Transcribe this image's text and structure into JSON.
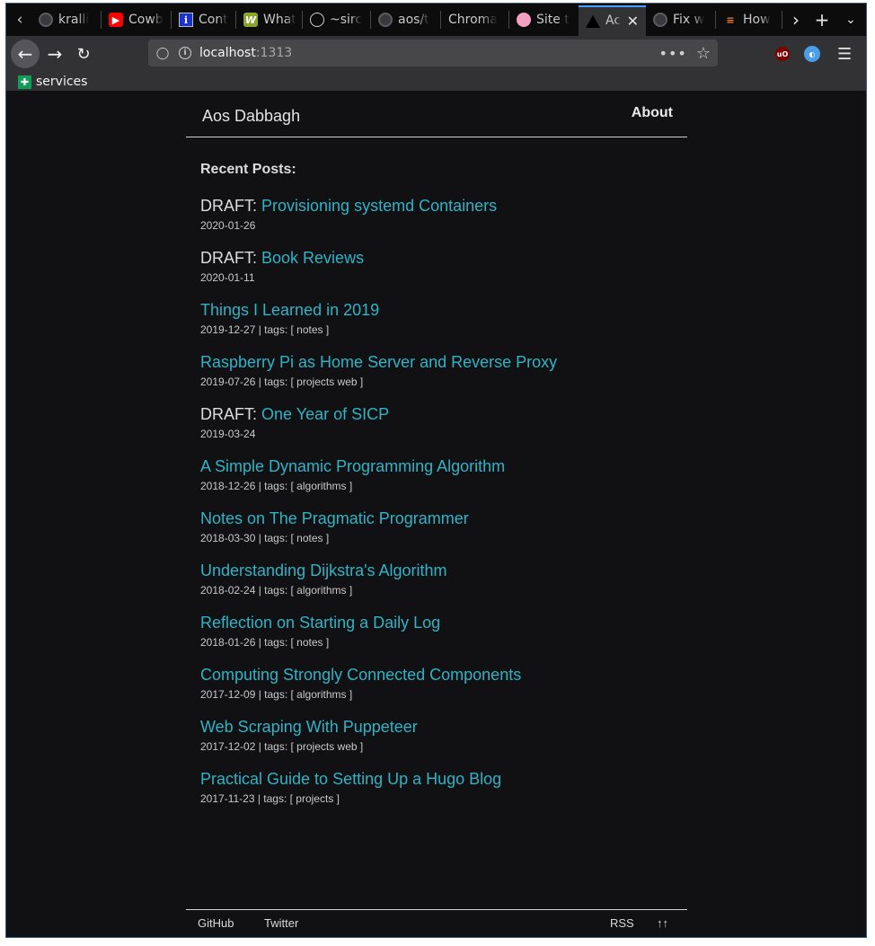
{
  "browser": {
    "tabs": [
      {
        "label": "kralli",
        "icon": "github-icon"
      },
      {
        "label": "Cowb",
        "icon": "youtube-icon"
      },
      {
        "label": "Cont",
        "icon": "info-icon"
      },
      {
        "label": "What",
        "icon": "w-icon"
      },
      {
        "label": "~sirc",
        "icon": "circle-icon"
      },
      {
        "label": "aos/t",
        "icon": "github-icon"
      },
      {
        "label": "Chroma",
        "icon": ""
      },
      {
        "label": "Site t",
        "icon": "site-icon"
      },
      {
        "label": "Ac",
        "icon": "triangle-icon",
        "active": true
      },
      {
        "label": "Fix w",
        "icon": "github-icon"
      },
      {
        "label": "How",
        "icon": "stackoverflow-icon"
      }
    ],
    "url_host": "localhost",
    "url_port": ":1313",
    "bookmarks": [
      {
        "label": "services",
        "icon": "google-sheets-icon"
      }
    ]
  },
  "site": {
    "title": "Aos Dabbagh",
    "nav_about": "About",
    "recent_heading": "Recent Posts:",
    "posts": [
      {
        "prefix": "DRAFT: ",
        "title": "Provisioning systemd Containers",
        "meta": "2020-01-26"
      },
      {
        "prefix": "DRAFT: ",
        "title": "Book Reviews",
        "meta": "2020-01-11"
      },
      {
        "prefix": "",
        "title": "Things I Learned in 2019",
        "meta": "2019-12-27 | tags: [ notes ]"
      },
      {
        "prefix": "",
        "title": "Raspberry Pi as Home Server and Reverse Proxy",
        "meta": "2019-07-26 | tags: [ projects web ]"
      },
      {
        "prefix": "DRAFT: ",
        "title": "One Year of SICP",
        "meta": "2019-03-24"
      },
      {
        "prefix": "",
        "title": "A Simple Dynamic Programming Algorithm",
        "meta": "2018-12-26 | tags: [ algorithms ]"
      },
      {
        "prefix": "",
        "title": "Notes on The Pragmatic Programmer",
        "meta": "2018-03-30 | tags: [ notes ]"
      },
      {
        "prefix": "",
        "title": "Understanding Dijkstra's Algorithm",
        "meta": "2018-02-24 | tags: [ algorithms ]"
      },
      {
        "prefix": "",
        "title": "Reflection on Starting a Daily Log",
        "meta": "2018-01-26 | tags: [ notes ]"
      },
      {
        "prefix": "",
        "title": "Computing Strongly Connected Components",
        "meta": "2017-12-09 | tags: [ algorithms ]"
      },
      {
        "prefix": "",
        "title": "Web Scraping With Puppeteer",
        "meta": "2017-12-02 | tags: [ projects web ]"
      },
      {
        "prefix": "",
        "title": "Practical Guide to Setting Up a Hugo Blog",
        "meta": "2017-11-23 | tags: [ projects ]"
      }
    ],
    "footer": {
      "github": "GitHub",
      "twitter": "Twitter",
      "rss": "RSS",
      "top": "↑↑"
    }
  },
  "colors": {
    "page_background": "#111113",
    "link": "#2fb3c6",
    "active_tab_accent": "#45a1ff"
  }
}
